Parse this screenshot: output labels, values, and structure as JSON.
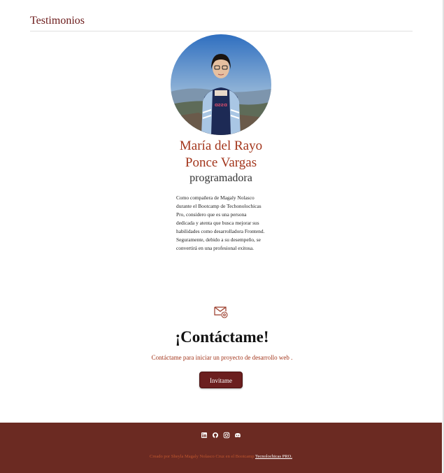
{
  "testimonials": {
    "section_title": "Testimonios",
    "person": {
      "name_line1": "María del Rayo",
      "name_line2": "Ponce Vargas",
      "role": "programadora",
      "quote": "Como compañera de Magaly Nolasco durante el Bootcamp de Techonolochicas Pro, considero que es una persona dedicada y atenta que busca mejorar sus habilidades como desarrolladora Frontend. Seguramente, debido a su desempeño, se convertirá en una profesional exitosa."
    }
  },
  "contact": {
    "icon": "envelope-at-icon",
    "title": "¡Contáctame!",
    "subtitle": "Contáctame para iniciar un proyecto de desarrollo web .",
    "button_label": "Invitame"
  },
  "footer": {
    "social_icons": [
      "linkedin-icon",
      "github-icon",
      "instagram-icon",
      "discord-icon"
    ],
    "credit_text": "Creado por Sheyla Magaly Nolasco Cruz en el Bootcamp ",
    "credit_link": "Tecnolochicas PRO."
  },
  "colors": {
    "accent": "#a3361c",
    "footer_bg": "#6b2a22",
    "button_bg": "#6b1f1f"
  }
}
